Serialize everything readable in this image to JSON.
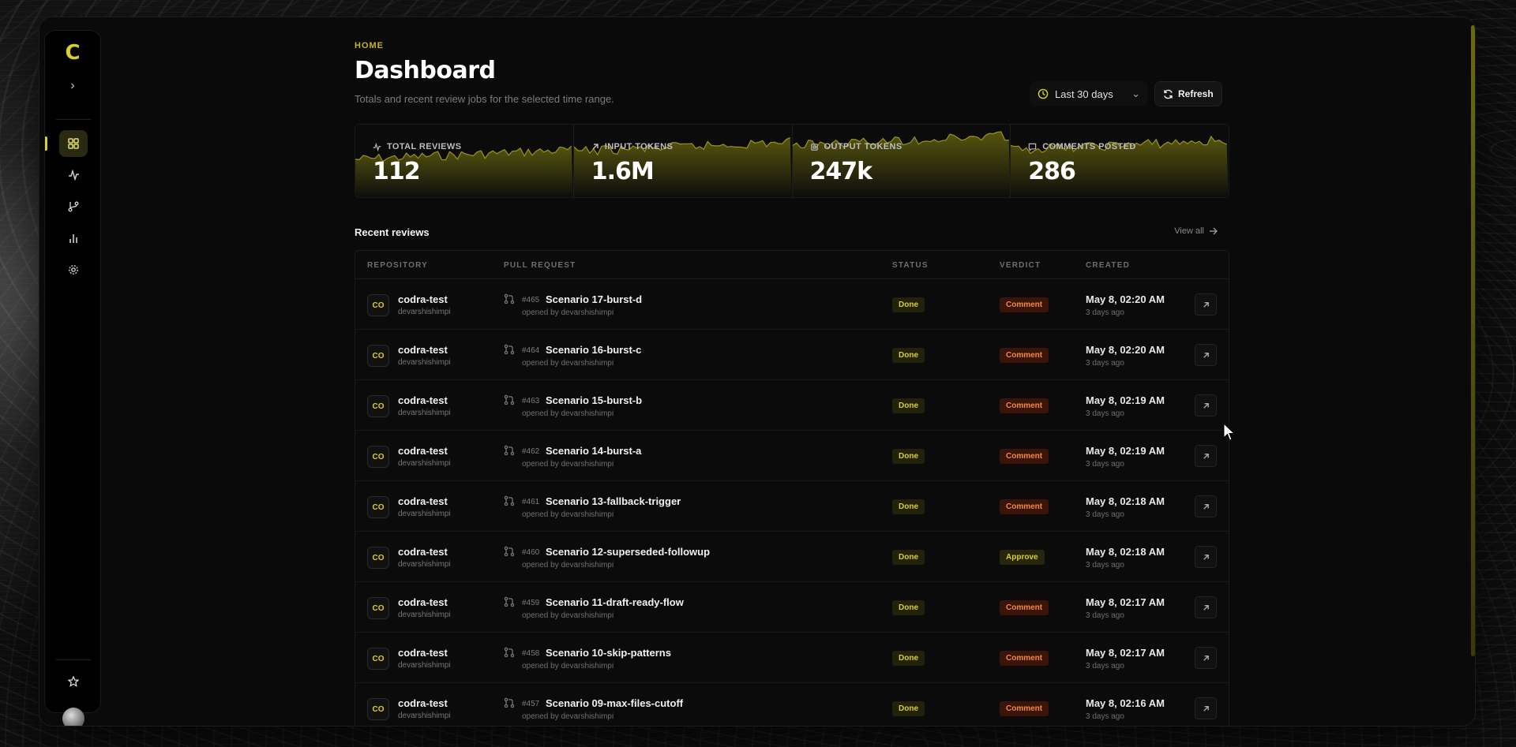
{
  "app": {
    "logo_icon": "codra-logo-icon",
    "accent": "#d6d22a"
  },
  "sidebar": {
    "expand_icon": "chevron-right-icon",
    "items": [
      {
        "name": "dashboard",
        "icon": "grid-icon",
        "active": true
      },
      {
        "name": "activity",
        "icon": "activity-icon",
        "active": false
      },
      {
        "name": "branches",
        "icon": "git-branch-icon",
        "active": false
      },
      {
        "name": "analytics",
        "icon": "bar-chart-icon",
        "active": false
      },
      {
        "name": "settings",
        "icon": "gear-icon",
        "active": false
      }
    ],
    "footer": [
      {
        "name": "favorites",
        "icon": "star-icon"
      },
      {
        "name": "profile",
        "icon": "avatar"
      }
    ]
  },
  "header": {
    "breadcrumb": "HOME",
    "title": "Dashboard",
    "subtitle": "Totals and recent review jobs for the selected time range.",
    "range_label": "Last 30 days",
    "refresh_label": "Refresh"
  },
  "stats": [
    {
      "label": "TOTAL REVIEWS",
      "value": "112",
      "icon": "activity-icon"
    },
    {
      "label": "INPUT TOKENS",
      "value": "1.6M",
      "icon": "arrow-up-right-icon"
    },
    {
      "label": "OUTPUT TOKENS",
      "value": "247k",
      "icon": "cpu-icon"
    },
    {
      "label": "COMMENTS POSTED",
      "value": "286",
      "icon": "message-icon"
    }
  ],
  "recent": {
    "heading": "Recent reviews",
    "view_all": "View all",
    "columns": {
      "repository": "REPOSITORY",
      "pull_request": "PULL REQUEST",
      "status": "STATUS",
      "verdict": "VERDICT",
      "created": "CREATED"
    },
    "rows": [
      {
        "badge": "CO",
        "repo": "codra-test",
        "owner": "devarshishimpi",
        "num": "#465",
        "title": "Scenario 17-burst-d",
        "by": "opened by devarshishimpi",
        "status": "Done",
        "verdict": "Comment",
        "created": "May 8, 02:20 AM",
        "ago": "3 days ago"
      },
      {
        "badge": "CO",
        "repo": "codra-test",
        "owner": "devarshishimpi",
        "num": "#464",
        "title": "Scenario 16-burst-c",
        "by": "opened by devarshishimpi",
        "status": "Done",
        "verdict": "Comment",
        "created": "May 8, 02:20 AM",
        "ago": "3 days ago"
      },
      {
        "badge": "CO",
        "repo": "codra-test",
        "owner": "devarshishimpi",
        "num": "#463",
        "title": "Scenario 15-burst-b",
        "by": "opened by devarshishimpi",
        "status": "Done",
        "verdict": "Comment",
        "created": "May 8, 02:19 AM",
        "ago": "3 days ago"
      },
      {
        "badge": "CO",
        "repo": "codra-test",
        "owner": "devarshishimpi",
        "num": "#462",
        "title": "Scenario 14-burst-a",
        "by": "opened by devarshishimpi",
        "status": "Done",
        "verdict": "Comment",
        "created": "May 8, 02:19 AM",
        "ago": "3 days ago"
      },
      {
        "badge": "CO",
        "repo": "codra-test",
        "owner": "devarshishimpi",
        "num": "#461",
        "title": "Scenario 13-fallback-trigger",
        "by": "opened by devarshishimpi",
        "status": "Done",
        "verdict": "Comment",
        "created": "May 8, 02:18 AM",
        "ago": "3 days ago"
      },
      {
        "badge": "CO",
        "repo": "codra-test",
        "owner": "devarshishimpi",
        "num": "#460",
        "title": "Scenario 12-superseded-followup",
        "by": "opened by devarshishimpi",
        "status": "Done",
        "verdict": "Approve",
        "created": "May 8, 02:18 AM",
        "ago": "3 days ago"
      },
      {
        "badge": "CO",
        "repo": "codra-test",
        "owner": "devarshishimpi",
        "num": "#459",
        "title": "Scenario 11-draft-ready-flow",
        "by": "opened by devarshishimpi",
        "status": "Done",
        "verdict": "Comment",
        "created": "May 8, 02:17 AM",
        "ago": "3 days ago"
      },
      {
        "badge": "CO",
        "repo": "codra-test",
        "owner": "devarshishimpi",
        "num": "#458",
        "title": "Scenario 10-skip-patterns",
        "by": "opened by devarshishimpi",
        "status": "Done",
        "verdict": "Comment",
        "created": "May 8, 02:17 AM",
        "ago": "3 days ago"
      },
      {
        "badge": "CO",
        "repo": "codra-test",
        "owner": "devarshishimpi",
        "num": "#457",
        "title": "Scenario 09-max-files-cutoff",
        "by": "opened by devarshishimpi",
        "status": "Done",
        "verdict": "Comment",
        "created": "May 8, 02:16 AM",
        "ago": "3 days ago"
      }
    ]
  }
}
